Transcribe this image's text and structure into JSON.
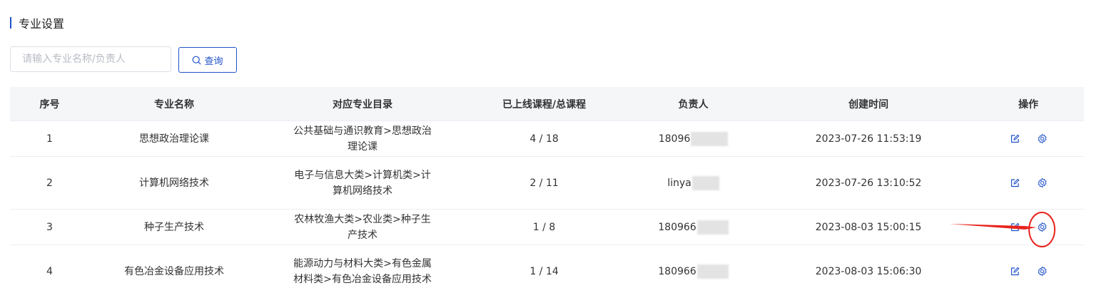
{
  "page": {
    "title": "专业设置"
  },
  "search": {
    "placeholder": "请输入专业名称/负责人",
    "value": "",
    "button_label": "查询"
  },
  "table": {
    "headers": [
      "序号",
      "专业名称",
      "对应专业目录",
      "已上线课程/总课程",
      "负责人",
      "创建时间",
      "操作"
    ],
    "rows": [
      {
        "index": "1",
        "name": "思想政治理论课",
        "directory": "公共基础与通识教育>思想政治理论课",
        "courses": "4 / 18",
        "owner": "18096",
        "created": "2023-07-26 11:53:19"
      },
      {
        "index": "2",
        "name": "计算机网络技术",
        "directory": "电子与信息大类>计算机类>计算机网络技术",
        "courses": "2 / 11",
        "owner": "linya",
        "created": "2023-07-26 13:10:52"
      },
      {
        "index": "3",
        "name": "种子生产技术",
        "directory": "农林牧渔大类>农业类>种子生产技术",
        "courses": "1 / 8",
        "owner": "180966",
        "created": "2023-08-03 15:00:15"
      },
      {
        "index": "4",
        "name": "有色冶金设备应用技术",
        "directory": "能源动力与材料大类>有色金属材料类>有色冶金设备应用技术",
        "courses": "1 / 14",
        "owner": "180966",
        "created": "2023-08-03 15:06:30"
      }
    ]
  },
  "icons": {
    "edit": "edit-icon",
    "settings": "settings-icon",
    "search": "search-icon"
  },
  "colors": {
    "accent": "#1f52c9",
    "annotation": "#e8231d",
    "header_bg": "#f5f6f8"
  }
}
